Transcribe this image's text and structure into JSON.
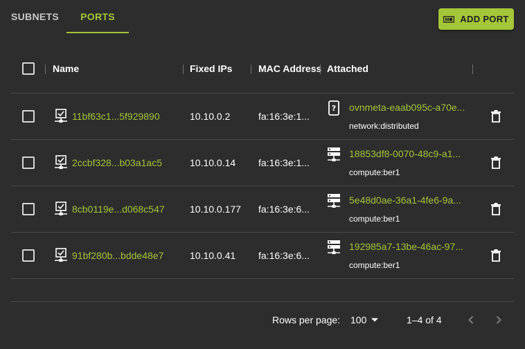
{
  "tabs": [
    {
      "label": "SUBNETS",
      "active": false
    },
    {
      "label": "PORTS",
      "active": true
    }
  ],
  "add_button": {
    "label": "ADD PORT",
    "icon": "ethernet-card-icon"
  },
  "table": {
    "columns": [
      "Name",
      "Fixed IPs",
      "MAC Address",
      "Attached"
    ],
    "rows": [
      {
        "name": "11bf63c1...5f929890",
        "fixed_ip": "10.10.0.2",
        "mac": "fa:16:3e:1...",
        "attached_name": "ovnmeta-eaab095c-a70e...",
        "attached_type": "network:distributed",
        "attached_icon": "unknown-device-icon"
      },
      {
        "name": "2ccbf328...b03a1ac5",
        "fixed_ip": "10.10.0.14",
        "mac": "fa:16:3e:1...",
        "attached_name": "18853df8-0070-48c9-a1...",
        "attached_type": "compute:ber1",
        "attached_icon": "server-icon"
      },
      {
        "name": "8cb0119e...d068c547",
        "fixed_ip": "10.10.0.177",
        "mac": "fa:16:3e:6...",
        "attached_name": "5e48d0ae-36a1-4fe6-9a...",
        "attached_type": "compute:ber1",
        "attached_icon": "server-icon"
      },
      {
        "name": "91bf280b...bdde48e7",
        "fixed_ip": "10.10.0.41",
        "mac": "fa:16:3e:6...",
        "attached_name": "192985a7-13be-46ac-97...",
        "attached_type": "compute:ber1",
        "attached_icon": "server-icon"
      }
    ]
  },
  "pagination": {
    "rows_per_page_label": "Rows per page:",
    "rows_per_page_value": "100",
    "range": "1–4 of 4"
  },
  "colors": {
    "accent": "#a4c639",
    "background": "#2d2d2d",
    "divider": "#4a4a4a"
  }
}
